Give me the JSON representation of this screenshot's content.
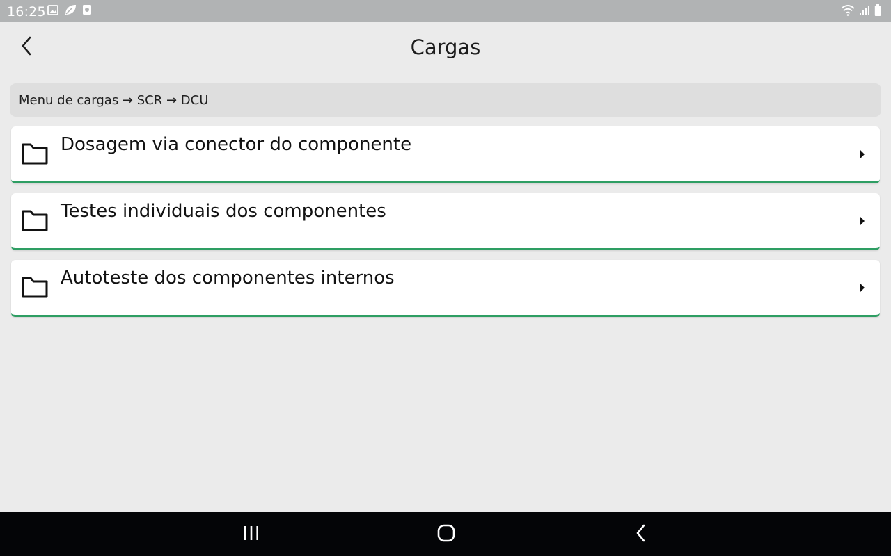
{
  "status_bar": {
    "time": "16:25",
    "left_icons": [
      "image-icon",
      "leaf-icon",
      "screenshot-icon"
    ],
    "right_icons": [
      "wifi-icon",
      "signal-icon",
      "battery-icon"
    ]
  },
  "header": {
    "title": "Cargas",
    "back_icon": "chevron-left-icon"
  },
  "breadcrumb": {
    "text": "Menu de cargas → SCR → DCU"
  },
  "list": {
    "items": [
      {
        "label": "Dosagem via conector do componente",
        "icon": "folder-icon"
      },
      {
        "label": "Testes individuais dos componentes",
        "icon": "folder-icon"
      },
      {
        "label": "Autoteste dos componentes internos",
        "icon": "folder-icon"
      }
    ]
  },
  "nav_bar": {
    "buttons": [
      "recent-apps-icon",
      "home-icon",
      "back-icon"
    ]
  },
  "colors": {
    "accent": "#2e9e63",
    "status_bar": "#b1b3b4",
    "nav_bar": "#040507",
    "background": "#ebebeb"
  }
}
